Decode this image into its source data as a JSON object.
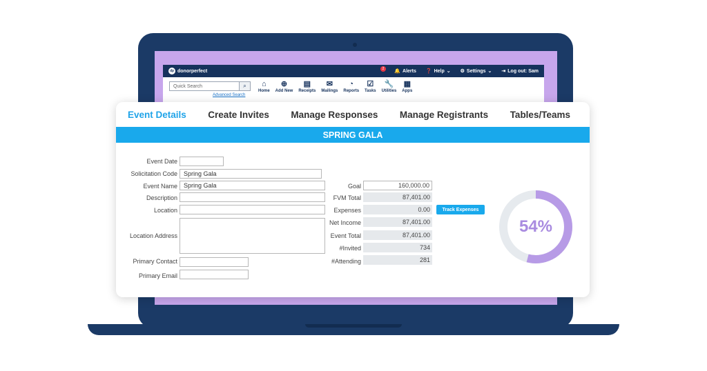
{
  "app": {
    "brand": "donorperfect",
    "alerts": {
      "label": "Alerts",
      "count": "2"
    },
    "help": "Help",
    "settings": "Settings",
    "logout": "Log out: Sam",
    "quick_search_placeholder": "Quick Search",
    "advanced_search": "Advanced Search",
    "nav": [
      {
        "label": "Home",
        "icon": "home-icon"
      },
      {
        "label": "Add New",
        "icon": "plus-circle-icon"
      },
      {
        "label": "Receipts",
        "icon": "receipt-icon"
      },
      {
        "label": "Mailings",
        "icon": "envelope-icon"
      },
      {
        "label": "Reports",
        "icon": "pie-chart-icon"
      },
      {
        "label": "Tasks",
        "icon": "checklist-icon"
      },
      {
        "label": "Utilities",
        "icon": "wrench-icon"
      },
      {
        "label": "Apps",
        "icon": "grid-icon"
      }
    ]
  },
  "tabs": [
    "Event Details",
    "Create Invites",
    "Manage Responses",
    "Manage Registrants",
    "Tables/Teams"
  ],
  "banner": "SPRING GALA",
  "form": {
    "event_date": {
      "label": "Event Date",
      "value": ""
    },
    "solicitation_code": {
      "label": "Solicitation Code",
      "value": "Spring Gala"
    },
    "event_name": {
      "label": "Event Name",
      "value": "Spring Gala"
    },
    "description": {
      "label": "Description",
      "value": ""
    },
    "location": {
      "label": "Location",
      "value": ""
    },
    "location_address": {
      "label": "Location Address",
      "value": ""
    },
    "primary_contact": {
      "label": "Primary Contact",
      "value": ""
    },
    "primary_email": {
      "label": "Primary Email",
      "value": ""
    }
  },
  "stats": {
    "goal": {
      "label": "Goal",
      "value": "160,000.00"
    },
    "fvm_total": {
      "label": "FVM Total",
      "value": "87,401.00"
    },
    "expenses": {
      "label": "Expenses",
      "value": "0.00"
    },
    "net_income": {
      "label": "Net Income",
      "value": "87,401.00"
    },
    "event_total": {
      "label": "Event Total",
      "value": "87,401.00"
    },
    "invited": {
      "label": "#Invited",
      "value": "734"
    },
    "attending": {
      "label": "#Attending",
      "value": "281"
    }
  },
  "track_expenses": "Track Expenses",
  "progress": {
    "label": "54%",
    "fraction": 0.54
  },
  "colors": {
    "accent": "#19a9ec",
    "donut": "#b79be6",
    "donut_track": "#e6eaee",
    "navy": "#16325c"
  }
}
